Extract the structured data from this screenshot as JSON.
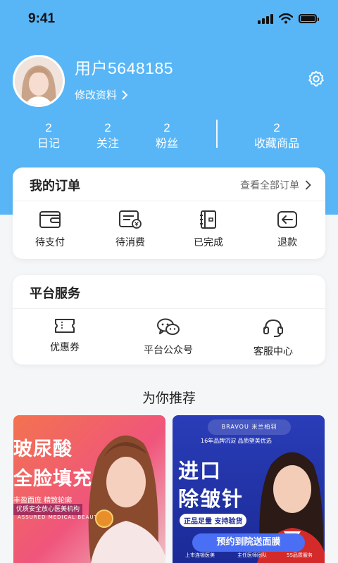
{
  "status": {
    "time": "9:41"
  },
  "profile": {
    "username": "用户5648185",
    "edit_label": "修改资料"
  },
  "stats": [
    {
      "value": "2",
      "label": "日记"
    },
    {
      "value": "2",
      "label": "关注"
    },
    {
      "value": "2",
      "label": "粉丝"
    },
    {
      "value": "2",
      "label": "收藏商品"
    }
  ],
  "orders": {
    "title": "我的订单",
    "view_all": "查看全部订单",
    "items": [
      {
        "label": "待支付",
        "icon": "wallet-icon"
      },
      {
        "label": "待消费",
        "icon": "receipt-icon"
      },
      {
        "label": "已完成",
        "icon": "notebook-icon"
      },
      {
        "label": "退款",
        "icon": "return-icon"
      }
    ]
  },
  "services": {
    "title": "平台服务",
    "items": [
      {
        "label": "优惠券",
        "icon": "ticket-icon"
      },
      {
        "label": "平台公众号",
        "icon": "wechat-icon"
      },
      {
        "label": "客服中心",
        "icon": "headset-icon"
      }
    ]
  },
  "recommend": {
    "title": "为你推荐",
    "left": {
      "headline1": "玻尿酸",
      "headline2": "全脸填充",
      "sub": "丰盈面庞 精致轮廓",
      "banner": "优质安全放心医美机构",
      "en": "ASSURED MEDICAL BEAUTY"
    },
    "right": {
      "brand": "BRAVOU 米兰柏羽",
      "tag": "16年品牌沉淀 品质塑美优选",
      "headline1": "进口",
      "headline2": "除皱针",
      "pill": "正品足量 支持验货",
      "button": "预约到院送面膜",
      "feat1": "上市连锁医美",
      "feat2": "主任医师团队",
      "feat3": "5S品质服务"
    }
  },
  "colors": {
    "hero_blue": "#58b6f7",
    "card_bg": "#ffffff",
    "page_bg": "#f5f6f8"
  }
}
